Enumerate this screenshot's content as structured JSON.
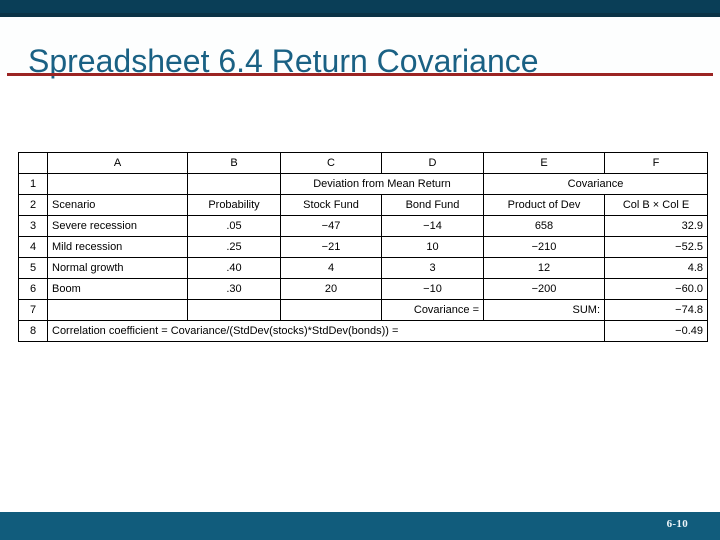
{
  "slide": {
    "title": "Spreadsheet 6.4 Return Covariance",
    "page_number": "6-10",
    "accent_color": "#1a6184",
    "rule_color": "#9b2423",
    "bar_color": "#0a3e57",
    "footer_color": "#115c7c",
    "highlight_color": "#c5e4f5"
  },
  "spreadsheet": {
    "column_headers": [
      "",
      "A",
      "B",
      "C",
      "D",
      "E",
      "F"
    ],
    "row_labels": [
      "1",
      "2",
      "3",
      "4",
      "5",
      "6",
      "7",
      "8"
    ],
    "row1": {
      "a": "",
      "b": "",
      "cd": "Deviation from Mean Return",
      "ef": "Covariance"
    },
    "row2": {
      "a": "Scenario",
      "b": "Probability",
      "c": "Stock Fund",
      "d": "Bond Fund",
      "e": "Product of Dev",
      "f": "Col B × Col E"
    },
    "data_rows": [
      {
        "n": "3",
        "a": "Severe recession",
        "b": ".05",
        "c": "−47",
        "d": "−14",
        "e": "658",
        "f": "32.9"
      },
      {
        "n": "4",
        "a": "Mild recession",
        "b": ".25",
        "c": "−21",
        "d": "10",
        "e": "−210",
        "f": "−52.5"
      },
      {
        "n": "5",
        "a": "Normal growth",
        "b": ".40",
        "c": "4",
        "d": "3",
        "e": "12",
        "f": "4.8"
      },
      {
        "n": "6",
        "a": "Boom",
        "b": ".30",
        "c": "20",
        "d": "−10",
        "e": "−200",
        "f": "−60.0"
      }
    ],
    "row7": {
      "a": "",
      "b": "",
      "c": "",
      "d": "Covariance =",
      "e": "SUM:",
      "f": "−74.8"
    },
    "row8": {
      "label": "Correlation coefficient = Covariance/(StdDev(stocks)*StdDev(bonds)) =",
      "f": "−0.49"
    }
  }
}
